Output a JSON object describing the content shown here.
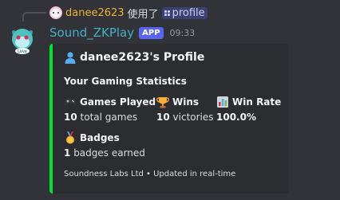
{
  "reply": {
    "username": "danee2623",
    "action": "使用了",
    "command": "profile"
  },
  "message": {
    "bot_name": "Sound_ZKPlay",
    "app_tag": "APP",
    "timestamp": "09:33",
    "avatar_label": "Love"
  },
  "embed": {
    "accent_color": "#00e02f",
    "title": "danee2623's Profile",
    "description": "Your Gaming Statistics",
    "fields": {
      "games_played": {
        "name": "Games Played",
        "value_number": "10",
        "value_suffix": "total games"
      },
      "wins": {
        "name": "Wins",
        "value_number": "10",
        "value_suffix": "victories"
      },
      "win_rate": {
        "name": "Win Rate",
        "value_number": "100.0%"
      },
      "badges": {
        "name": "Badges",
        "value_number": "1",
        "value_suffix": "badges earned"
      }
    },
    "footer": "Soundness Labs Ltd • Updated in real-time"
  },
  "icons": {
    "title": "bust-in-silhouette-icon",
    "games_played": "game-controller-icon",
    "wins": "trophy-icon",
    "win_rate": "bar-chart-icon",
    "badges": "medal-icon",
    "command": "slash-command-icon"
  }
}
